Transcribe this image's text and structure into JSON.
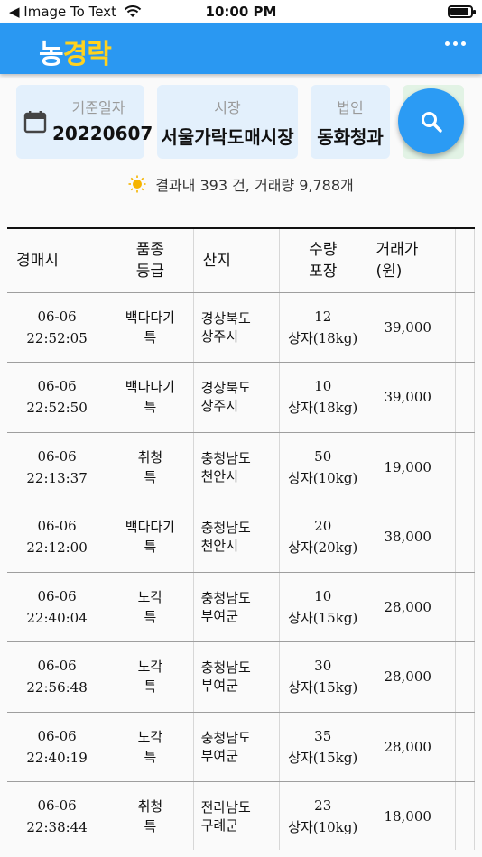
{
  "status_bar": {
    "back_label": "◀ Image To Text",
    "time": "10:00 PM",
    "battery_level": 0.9
  },
  "app": {
    "logo_part1": "농",
    "logo_part2": "경락"
  },
  "filters": {
    "date": {
      "label": "기준일자",
      "value": "20220607"
    },
    "market": {
      "label": "시장",
      "value": "서울가락도매시장"
    },
    "corp": {
      "label": "법인",
      "value": "동화청과"
    }
  },
  "summary": {
    "text": "결과내 393 건, 거래량 9,788개"
  },
  "colors": {
    "accent": "#2a98f2",
    "logo_yellow": "#ffd21f",
    "chip_bg": "#e3f0fc",
    "fab": "#2b9bf4"
  },
  "icons": {
    "calendar": "calendar-icon",
    "search": "search-icon",
    "sun": "sun-icon",
    "menu": "more-dots-icon",
    "wifi": "wifi-icon",
    "battery": "battery-icon"
  },
  "table": {
    "headers": [
      {
        "line1": "경매시",
        "line2": ""
      },
      {
        "line1": "품종",
        "line2": "등급"
      },
      {
        "line1": "산지",
        "line2": ""
      },
      {
        "line1": "수량",
        "line2": "포장"
      },
      {
        "line1": "거래가",
        "line2": "(원)"
      }
    ],
    "rows": [
      {
        "date": "06-06",
        "time": "22:52:05",
        "variety": "백다다기",
        "grade": "특",
        "origin1": "경상북도",
        "origin2": "상주시",
        "qty": "12",
        "pack": "상자(18kg)",
        "price": "39,000"
      },
      {
        "date": "06-06",
        "time": "22:52:50",
        "variety": "백다다기",
        "grade": "특",
        "origin1": "경상북도",
        "origin2": "상주시",
        "qty": "10",
        "pack": "상자(18kg)",
        "price": "39,000"
      },
      {
        "date": "06-06",
        "time": "22:13:37",
        "variety": "취청",
        "grade": "특",
        "origin1": "충청남도",
        "origin2": "천안시",
        "qty": "50",
        "pack": "상자(10kg)",
        "price": "19,000"
      },
      {
        "date": "06-06",
        "time": "22:12:00",
        "variety": "백다다기",
        "grade": "특",
        "origin1": "충청남도",
        "origin2": "천안시",
        "qty": "20",
        "pack": "상자(20kg)",
        "price": "38,000"
      },
      {
        "date": "06-06",
        "time": "22:40:04",
        "variety": "노각",
        "grade": "특",
        "origin1": "충청남도",
        "origin2": "부여군",
        "qty": "10",
        "pack": "상자(15kg)",
        "price": "28,000"
      },
      {
        "date": "06-06",
        "time": "22:56:48",
        "variety": "노각",
        "grade": "특",
        "origin1": "충청남도",
        "origin2": "부여군",
        "qty": "30",
        "pack": "상자(15kg)",
        "price": "28,000"
      },
      {
        "date": "06-06",
        "time": "22:40:19",
        "variety": "노각",
        "grade": "특",
        "origin1": "충청남도",
        "origin2": "부여군",
        "qty": "35",
        "pack": "상자(15kg)",
        "price": "28,000"
      },
      {
        "date": "06-06",
        "time": "22:38:44",
        "variety": "취청",
        "grade": "특",
        "origin1": "전라남도",
        "origin2": "구례군",
        "qty": "23",
        "pack": "상자(10kg)",
        "price": "18,000"
      }
    ]
  }
}
